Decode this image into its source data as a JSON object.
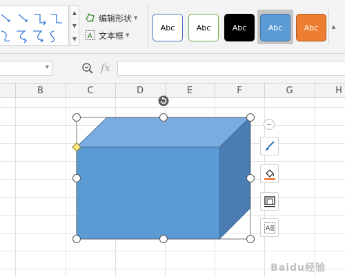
{
  "ribbon": {
    "edit_shape_label": "编辑形状",
    "textbox_label": "文本框",
    "style_presets": [
      {
        "label": "Abc",
        "bg": "#ffffff",
        "border": "#4a72c4",
        "color": "#000000"
      },
      {
        "label": "Abc",
        "bg": "#ffffff",
        "border": "#70ad47",
        "color": "#000000"
      },
      {
        "label": "Abc",
        "bg": "#000000",
        "border": "#000000",
        "color": "#ffffff"
      },
      {
        "label": "Abc",
        "bg": "#5b9bd5",
        "border": "#41719c",
        "color": "#ffffff"
      },
      {
        "label": "Abc",
        "bg": "#ed7d31",
        "border": "#ae5a21",
        "color": "#ffffff"
      }
    ],
    "selected_preset_index": 3
  },
  "formula_bar": {
    "name_box_value": "",
    "fx_label": "fx",
    "formula_value": ""
  },
  "columns": [
    "B",
    "C",
    "D",
    "E",
    "F",
    "G",
    "H"
  ],
  "shape": {
    "type": "cube",
    "front_color": "#5b9bd5",
    "top_color": "#7dafe0",
    "side_color": "#4779b0",
    "outline_color": "#41719c",
    "adjust_handle_color": "#ffeb80"
  },
  "side_toolbar": {
    "icons": [
      "shape-style-icon",
      "fill-icon",
      "outline-icon",
      "text-wrap-icon"
    ]
  },
  "watermark": "Baidu经验"
}
